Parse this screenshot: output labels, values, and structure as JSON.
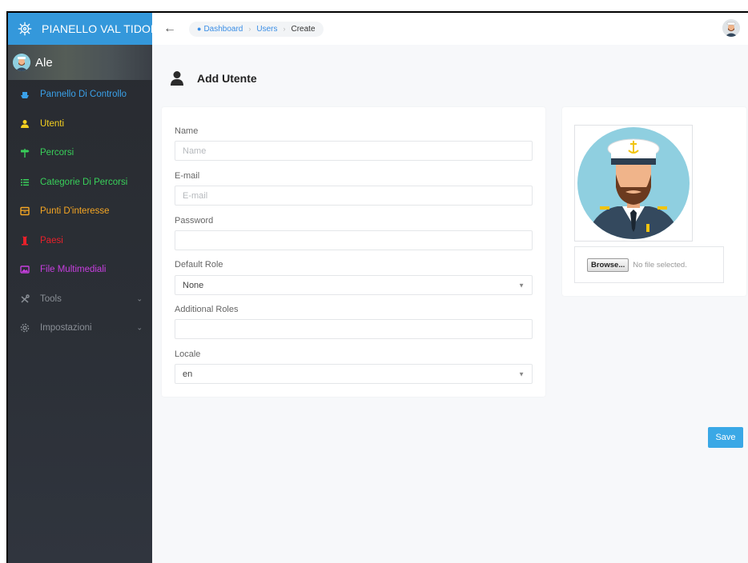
{
  "brand": {
    "title": "PIANELLO VAL TIDONE"
  },
  "user": {
    "name": "Ale"
  },
  "sidebar": {
    "items": [
      {
        "label": "Pannello Di Controllo",
        "icon": "ship-icon",
        "color": "#3aa0e8"
      },
      {
        "label": "Utenti",
        "icon": "user-icon",
        "color": "#f5d020"
      },
      {
        "label": "Percorsi",
        "icon": "signpost-icon",
        "color": "#39d05a"
      },
      {
        "label": "Categorie Di Percorsi",
        "icon": "list-icon",
        "color": "#39d05a"
      },
      {
        "label": "Punti D'interesse",
        "icon": "archive-icon",
        "color": "#f5a623"
      },
      {
        "label": "Paesi",
        "icon": "tower-icon",
        "color": "#e8202a"
      },
      {
        "label": "File Multimediali",
        "icon": "image-icon",
        "color": "#c83ee0"
      },
      {
        "label": "Tools",
        "icon": "tools-icon",
        "color": "#8a8f96"
      },
      {
        "label": "Impostazioni",
        "icon": "gear-icon",
        "color": "#8a8f96"
      }
    ]
  },
  "breadcrumb": {
    "dashboard": "Dashboard",
    "users": "Users",
    "current": "Create",
    "sep": "›"
  },
  "page": {
    "title": "Add Utente"
  },
  "form": {
    "name_label": "Name",
    "name_placeholder": "Name",
    "email_label": "E-mail",
    "email_placeholder": "E-mail",
    "password_label": "Password",
    "password_value": "",
    "role_label": "Default Role",
    "role_value": "None",
    "additional_label": "Additional Roles",
    "additional_value": "",
    "locale_label": "Locale",
    "locale_value": "en"
  },
  "upload": {
    "browse_label": "Browse...",
    "status": "No file selected."
  },
  "actions": {
    "save_label": "Save"
  },
  "colors": {
    "accent": "#3498db",
    "save": "#3aa8e6",
    "sidebar_bg": "#2b2f36"
  }
}
